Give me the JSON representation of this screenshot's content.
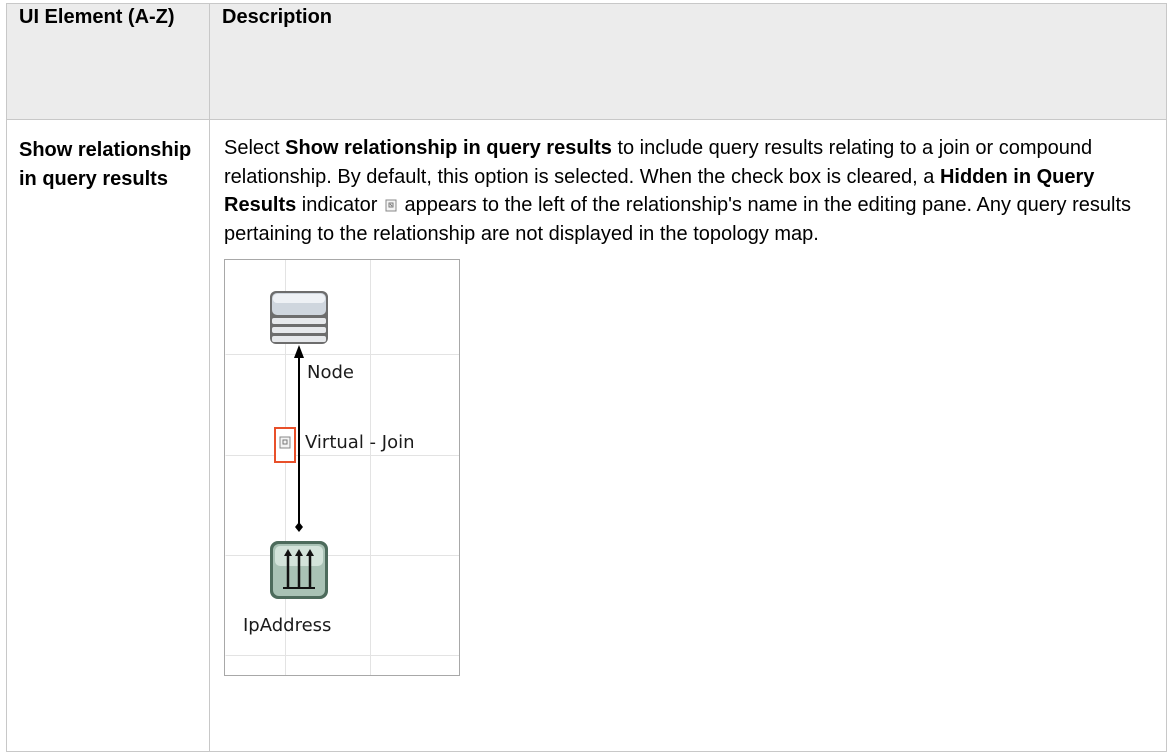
{
  "table": {
    "headers": [
      "UI Element (A-Z)",
      "Description"
    ],
    "row": {
      "element": "Show relationship in query results",
      "desc_before_1": "Select ",
      "bold_1": "Show relationship in query results",
      "desc_after_1": " to include query results relating to a join or compound relationship. By default, this option is selected. When the check box is cleared, a ",
      "bold_2": "Hidden in Query Results",
      "desc_after_2": " indicator",
      "desc_after_icon": " appears to the left of the relationship's name in the editing pane. Any query results pertaining to the relationship are not displayed in the topology map."
    }
  },
  "figure": {
    "node_label": "Node",
    "edge_label": "Virtual - Join",
    "target_label": "IpAddress",
    "highlight_color": "#e8502a",
    "node_icon": "database-server-icon",
    "target_icon": "ip-address-icon"
  }
}
